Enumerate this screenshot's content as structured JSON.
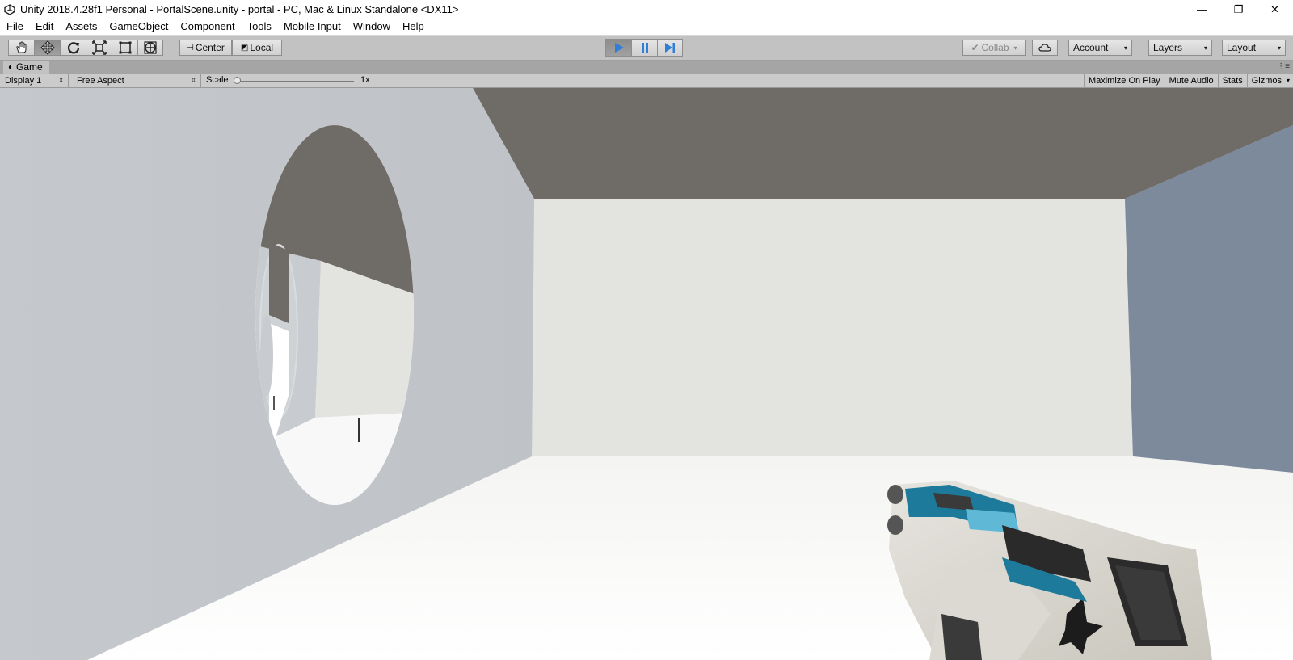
{
  "window": {
    "title": "Unity 2018.4.28f1 Personal - PortalScene.unity - portal - PC, Mac & Linux Standalone <DX11>",
    "controls": {
      "minimize": "—",
      "restore": "❐",
      "close": "✕"
    }
  },
  "menu": [
    "File",
    "Edit",
    "Assets",
    "GameObject",
    "Component",
    "Tools",
    "Mobile Input",
    "Window",
    "Help"
  ],
  "toolbar": {
    "tools": [
      "hand-tool-icon",
      "move-tool-icon",
      "rotate-tool-icon",
      "scale-tool-icon",
      "rect-tool-icon",
      "transform-tool-icon"
    ],
    "pivot_label": "Center",
    "space_label": "Local",
    "collab_label": "Collab",
    "account_label": "Account",
    "layers_label": "Layers",
    "layout_label": "Layout",
    "accent_color": "#2f7fd8"
  },
  "game_tab": {
    "label": "Game",
    "display": "Display 1",
    "aspect": "Free Aspect",
    "scale_label": "Scale",
    "scale_value": "1x",
    "maximize_label": "Maximize On Play",
    "mute_label": "Mute Audio",
    "stats_label": "Stats",
    "gizmos_label": "Gizmos"
  }
}
